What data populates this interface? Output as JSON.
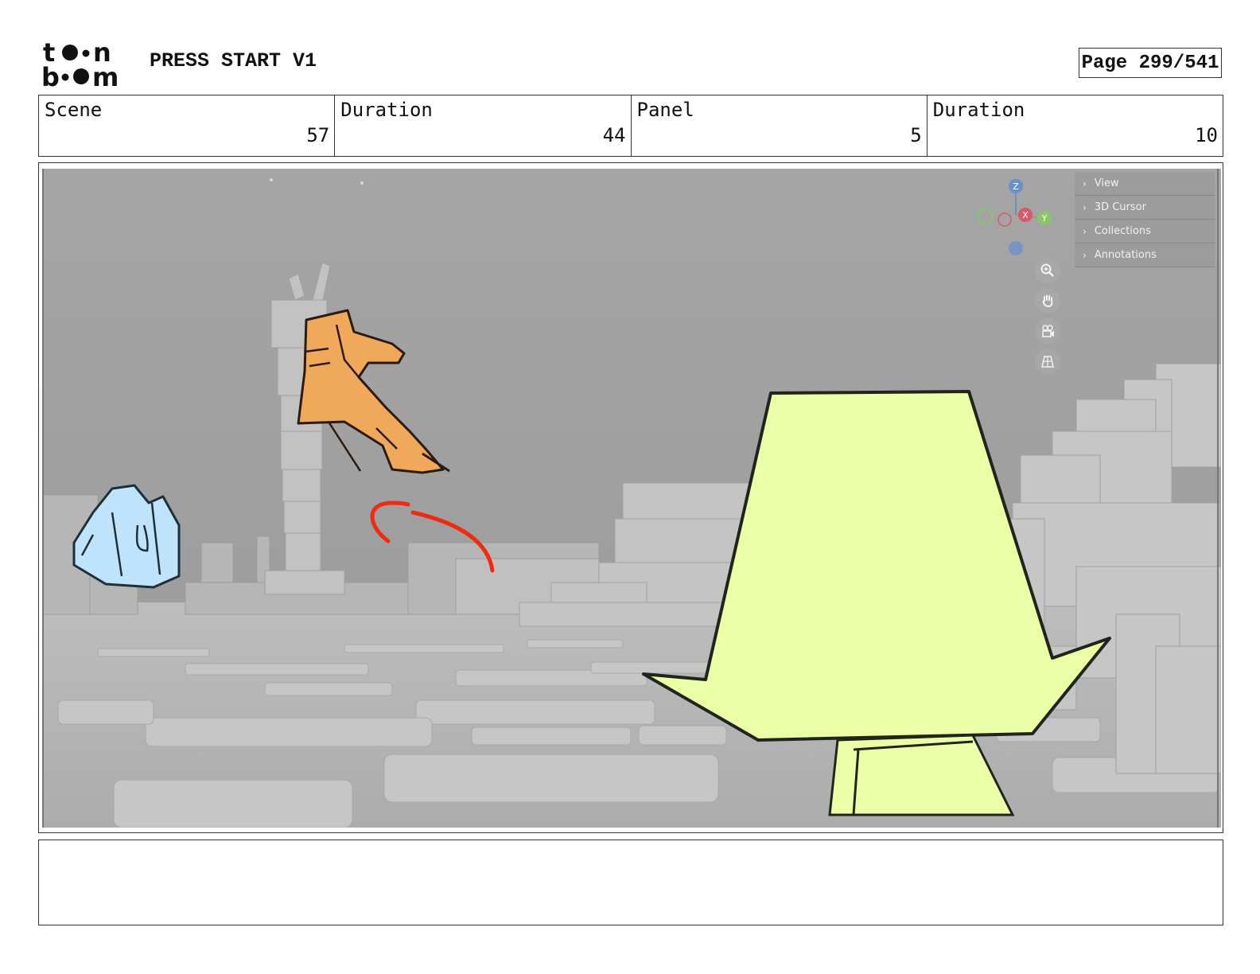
{
  "header": {
    "logo_text_top": "to•n",
    "logo_text_bottom": "b•om",
    "project_title": "PRESS START V1",
    "page_label": "Page 299/541"
  },
  "info": {
    "scene_label": "Scene",
    "scene_value": "57",
    "scene_duration_label": "Duration",
    "scene_duration_value": "44",
    "panel_label": "Panel",
    "panel_value": "5",
    "panel_duration_label": "Duration",
    "panel_duration_value": "10"
  },
  "viewport": {
    "menu_items": [
      {
        "label": "View"
      },
      {
        "label": "3D Cursor"
      },
      {
        "label": "Collections"
      },
      {
        "label": "Annotations"
      }
    ],
    "gizmo": {
      "z": "Z",
      "x": "X",
      "y": "Y"
    },
    "tools": [
      "zoom-icon",
      "hand-pan-icon",
      "camera-icon",
      "grid-icon"
    ],
    "colors": {
      "sky": "#a3a3a3",
      "ground": "#b9b9b9",
      "yellow_character": "#ebffa6",
      "orange_character": "#f0a95a",
      "blue_character": "#bfe3fb",
      "red_arrow": "#ee2b10"
    }
  },
  "notes": {
    "text": ""
  }
}
